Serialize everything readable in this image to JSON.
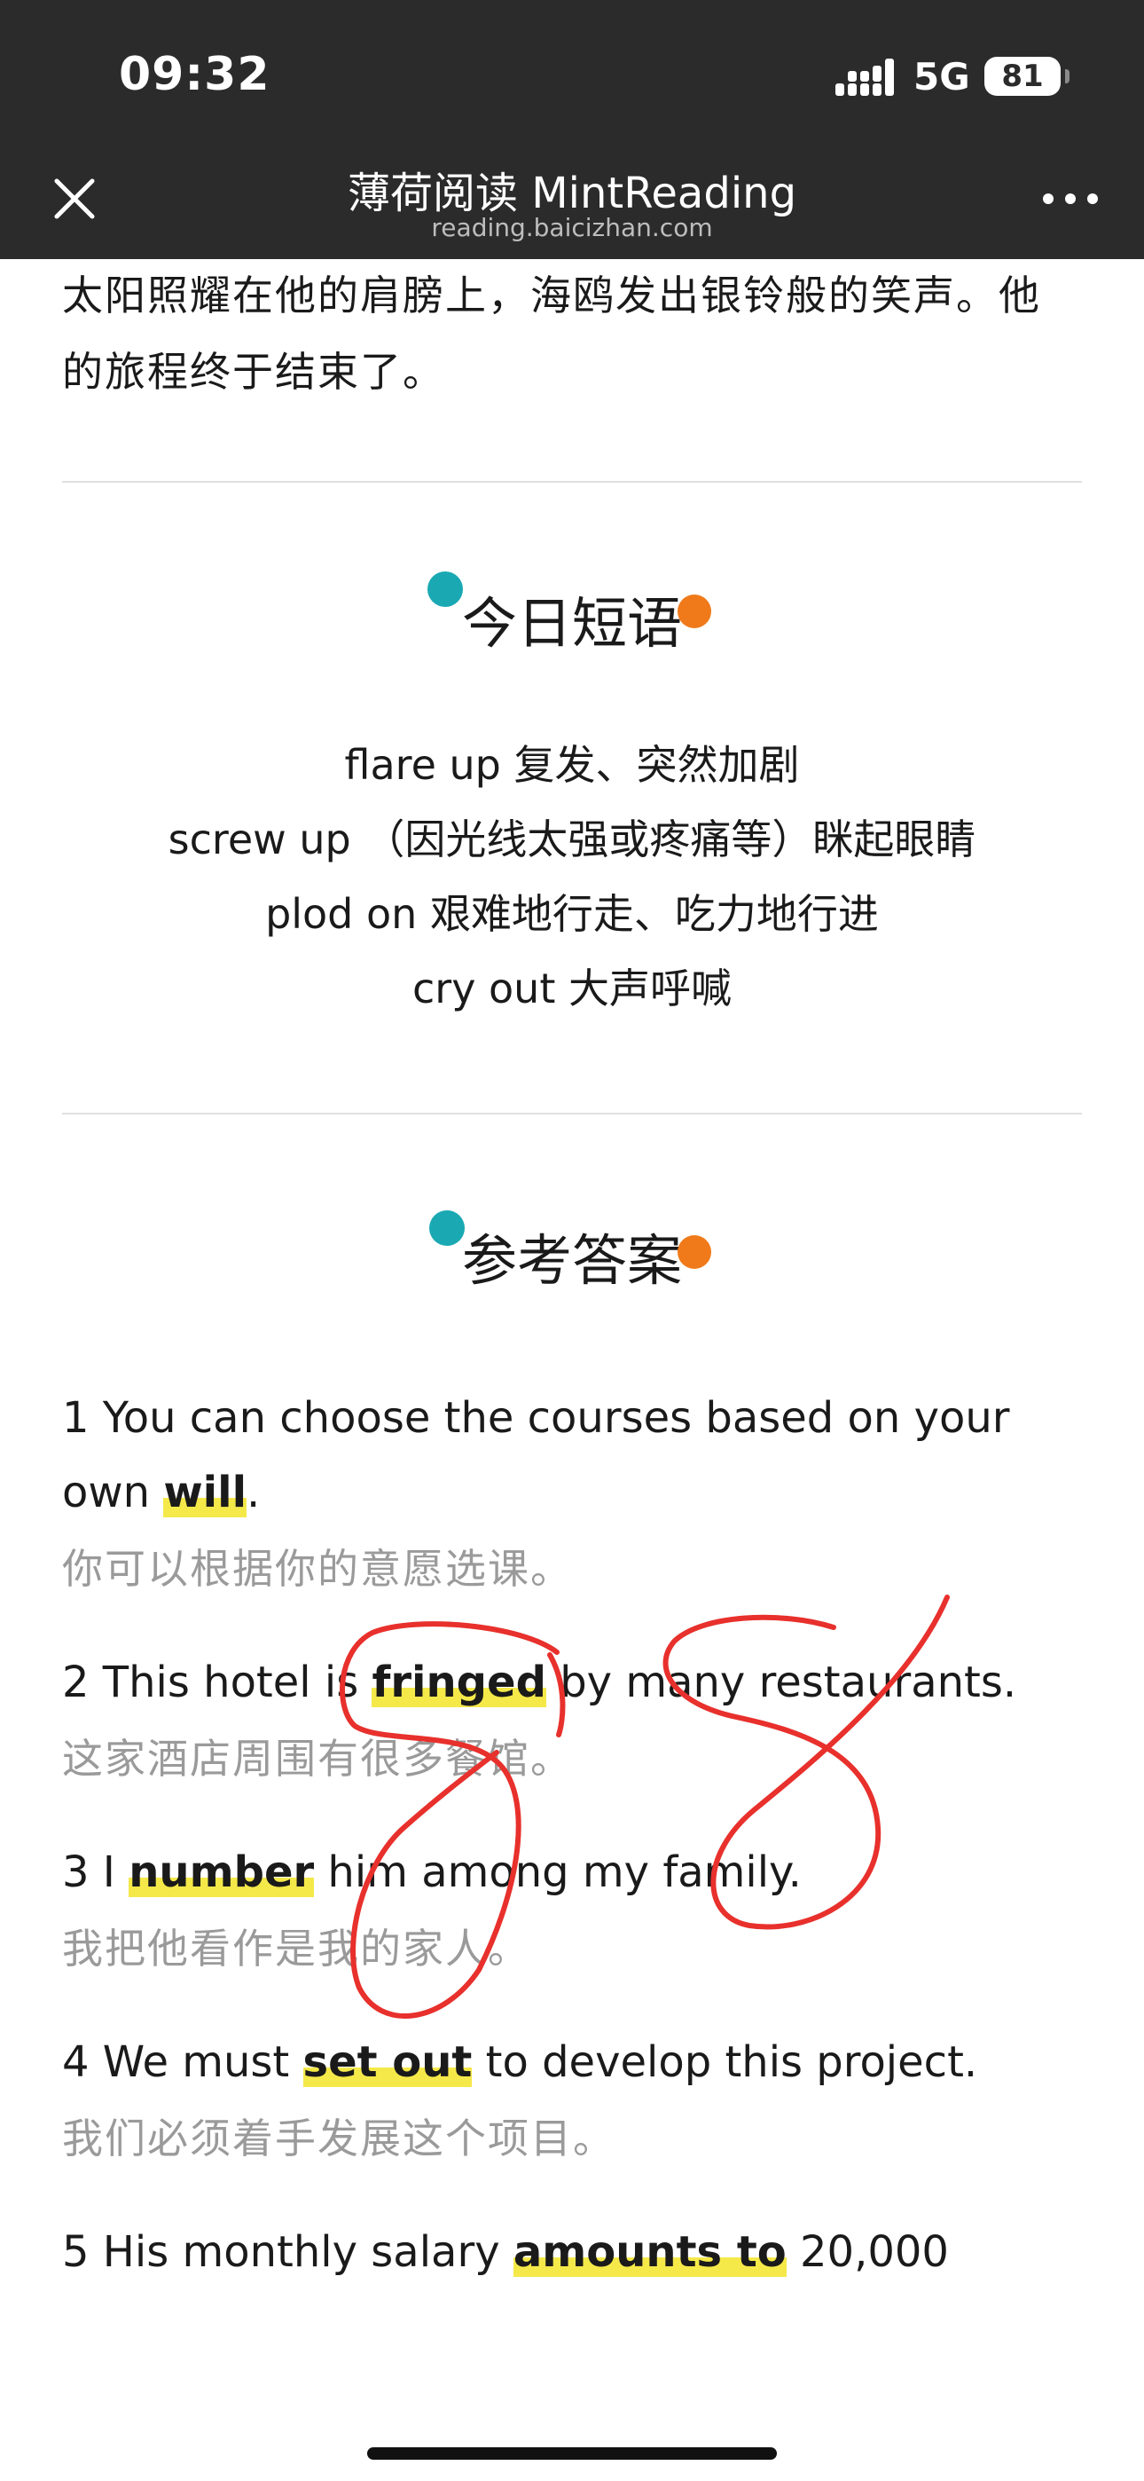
{
  "status_bar": {
    "time": "09:32",
    "network": "5G",
    "battery": "81"
  },
  "nav": {
    "title": "薄荷阅读 MintReading",
    "subtitle": "reading.baicizhan.com",
    "close_icon": "close-icon",
    "more_icon": "more-dots-icon"
  },
  "story_tail": "太阳照耀在他的肩膀上，海鸥发出银铃般的笑声。他的旅程终于结束了。",
  "phrases_section": {
    "title": "今日短语",
    "items": [
      "flare up 复发、突然加剧",
      "screw up （因光线太强或疼痛等）眯起眼睛",
      "plod on 艰难地行走、吃力地行进",
      "cry out 大声呼喊"
    ]
  },
  "answers_section": {
    "title": "参考答案",
    "items": [
      {
        "pre": "1 You can choose the courses based on your own ",
        "key": "will",
        "post": ".",
        "zh": "你可以根据你的意愿选课。"
      },
      {
        "pre": "2 This hotel is ",
        "key": "fringed",
        "post": " by many restaurants.",
        "zh": "这家酒店周围有很多餐馆。"
      },
      {
        "pre": "3 I ",
        "key": "number",
        "post": " him among my family.",
        "zh": "我把他看作是我的家人。"
      },
      {
        "pre": "4 We must ",
        "key": "set out",
        "post": " to develop this project.",
        "zh": "我们必须着手发展这个项目。"
      },
      {
        "pre": "5 His monthly salary ",
        "key": "amounts to",
        "post": " 20,000",
        "zh": ""
      }
    ]
  },
  "colors": {
    "topbar": "#2b2b2b",
    "highlight": "#f5e94a",
    "dot_teal": "#1aa9b3",
    "dot_orange": "#f07a1a",
    "scribble": "#e8302c"
  }
}
